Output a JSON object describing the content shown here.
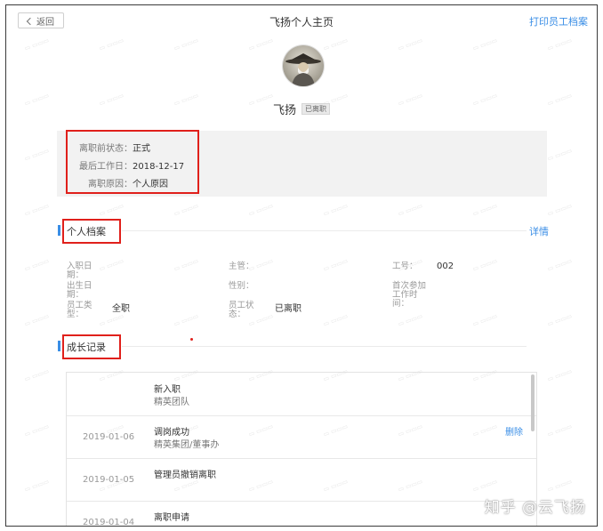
{
  "header": {
    "back_label": "返回",
    "title": "飞扬个人主页",
    "print_label": "打印员工档案"
  },
  "profile": {
    "name": "飞扬",
    "status_badge": "已离职"
  },
  "departure": {
    "status_label": "离职前状态：",
    "status_value": "正式",
    "last_day_label": "最后工作日：",
    "last_day_value": "2018-12-17",
    "reason_label": "离职原因：",
    "reason_value": "个人原因"
  },
  "archive": {
    "title": "个人档案",
    "detail_label": "详情",
    "hire_date_label": "入职日期：",
    "supervisor_label": "主管：",
    "employee_id_label": "工号：",
    "employee_id_value": "002",
    "birth_date_label": "出生日期：",
    "gender_label": "性别：",
    "first_work_label": "首次参加工作时间：",
    "employee_type_label": "员工类型：",
    "employee_type_value": "全职",
    "employee_status_label": "员工状态：",
    "employee_status_value": "已离职"
  },
  "growth": {
    "title": "成长记录",
    "records": [
      {
        "date": "",
        "title": "新入职",
        "detail": "精英团队",
        "action": ""
      },
      {
        "date": "2019-01-06",
        "title": "调岗成功",
        "detail": "精英集团/董事办",
        "action": "删除"
      },
      {
        "date": "2019-01-05",
        "title": "管理员撤销离职",
        "detail": "",
        "action": ""
      },
      {
        "date": "2019-01-04",
        "title": "离职申请",
        "detail": "",
        "action": ""
      }
    ]
  },
  "watermark": {
    "brand": "知乎 @云飞扬"
  },
  "colors": {
    "accent": "#3a8ee6",
    "highlight_red": "#e0201b",
    "panel_bg": "#f2f2f2"
  }
}
